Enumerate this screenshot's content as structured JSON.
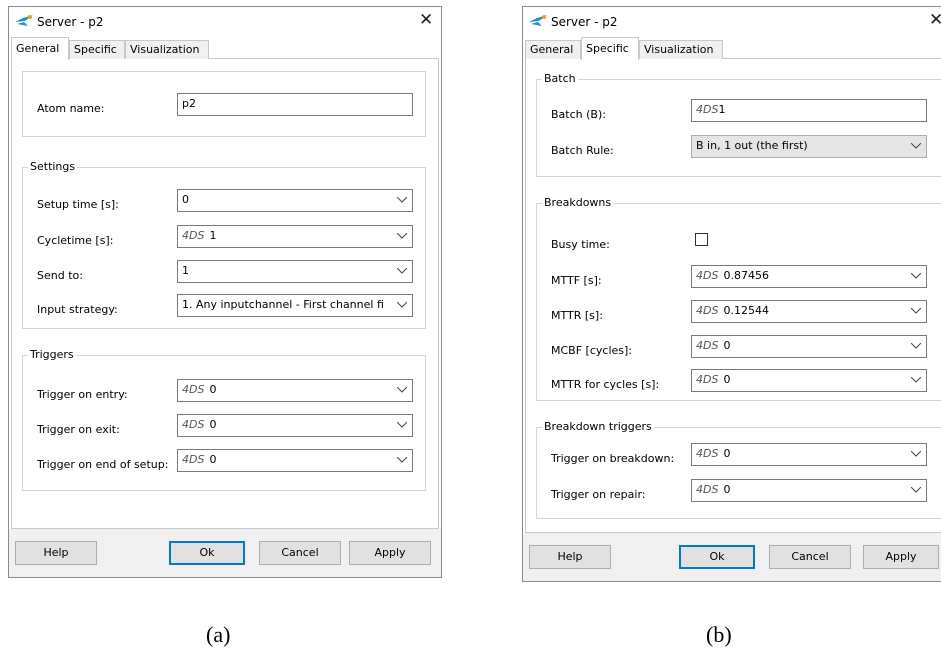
{
  "dialogA": {
    "title": "Server - p2",
    "tabs": [
      "General",
      "Specific",
      "Visualization"
    ],
    "atom_label": "Atom name:",
    "atom_value": "p2",
    "settings": {
      "title": "Settings",
      "setup_label": "Setup time [s]:",
      "setup_value": "0",
      "cycle_label": "Cycletime [s]:",
      "cycle_value": "1",
      "send_label": "Send to:",
      "send_value": "1",
      "input_label": "Input strategy:",
      "input_value": "1. Any inputchannel -  First channel fi"
    },
    "triggers": {
      "title": "Triggers",
      "entry_label": "Trigger on entry:",
      "entry_value": "0",
      "exit_label": "Trigger on exit:",
      "exit_value": "0",
      "setup_label": "Trigger on end of setup:",
      "setup_value": "0"
    },
    "buttons": {
      "help": "Help",
      "ok": "Ok",
      "cancel": "Cancel",
      "apply": "Apply"
    }
  },
  "dialogB": {
    "title": "Server - p2",
    "tabs": [
      "General",
      "Specific",
      "Visualization"
    ],
    "batch": {
      "title": "Batch",
      "batch_label": "Batch (B):",
      "batch_value": "1",
      "rule_label": "Batch Rule:",
      "rule_value": "B in, 1 out (the first)"
    },
    "breakdowns": {
      "title": "Breakdowns",
      "busy_label": "Busy time:",
      "busy_checked": false,
      "mttf_label": "MTTF [s]:",
      "mttf_value": "0.87456",
      "mttr_label": "MTTR [s]:",
      "mttr_value": "0.12544",
      "mcbf_label": "MCBF [cycles]:",
      "mcbf_value": "0",
      "mttrc_label": "MTTR for cycles [s]:",
      "mttrc_value": "0"
    },
    "triggers": {
      "title": "Breakdown triggers",
      "breakdown_label": "Trigger on breakdown:",
      "breakdown_value": "0",
      "repair_label": "Trigger on repair:",
      "repair_value": "0"
    },
    "buttons": {
      "help": "Help",
      "ok": "Ok",
      "cancel": "Cancel",
      "apply": "Apply"
    }
  },
  "prefix_4ds": "4DS",
  "captions": {
    "a": "(a)",
    "b": "(b)"
  },
  "icons": {
    "app": "app-logo-icon",
    "close": "close-icon",
    "dropdown": "chevron-down-icon"
  },
  "colors": {
    "default_button_border": "#0078d7",
    "app_icon": "#1e90d6"
  }
}
